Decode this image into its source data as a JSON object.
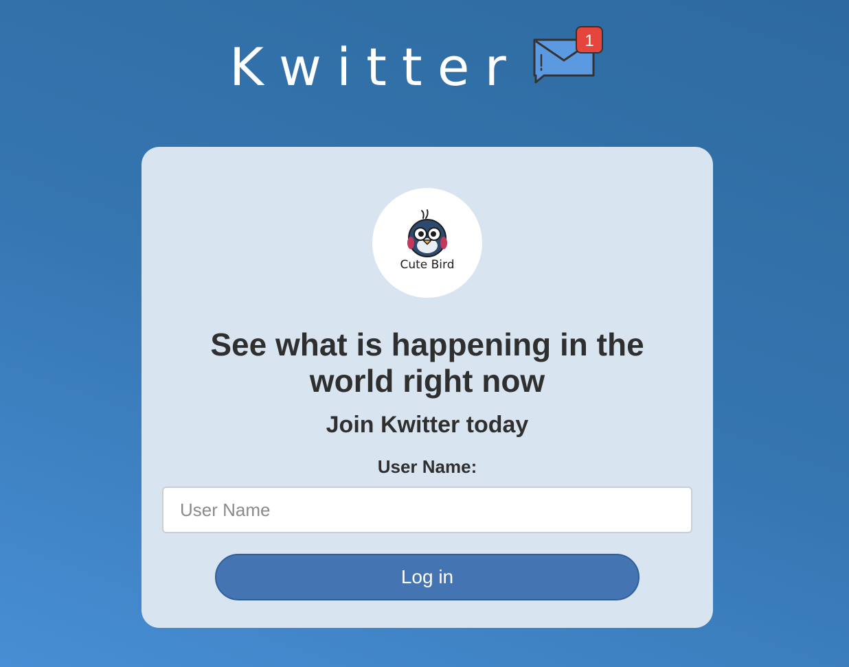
{
  "brand": {
    "title": "Kwitter",
    "notification_count": "1"
  },
  "card": {
    "avatar_caption": "Cute Bird",
    "headline": "See what is happening in the world right now",
    "subhead": "Join Kwitter today",
    "username_label": "User Name:",
    "username_placeholder": "User Name",
    "username_value": "",
    "login_label": "Log in"
  },
  "colors": {
    "accent": "#4474b2",
    "card_background": "#d8e4f0",
    "badge": "#e4453d"
  },
  "icons": {
    "mail": "mail-icon",
    "bird": "bird-logo-icon"
  }
}
